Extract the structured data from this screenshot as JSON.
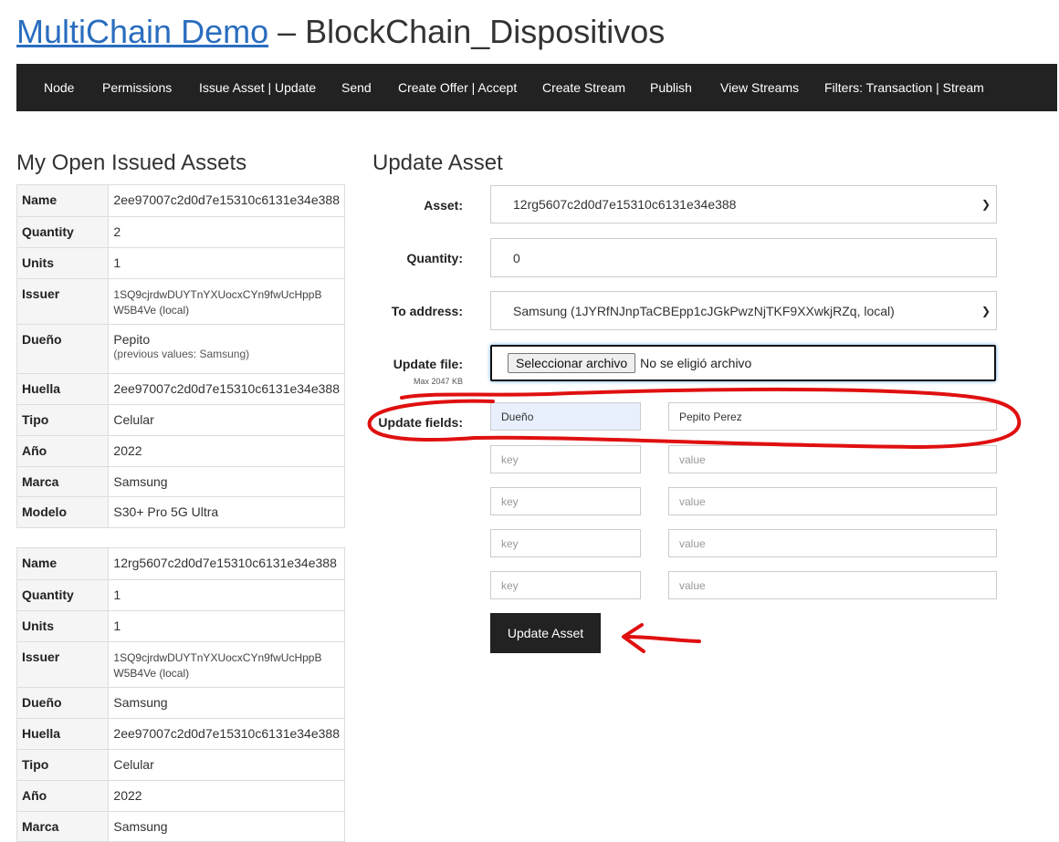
{
  "header": {
    "link_text": "MultiChain Demo",
    "rest": " – BlockChain_Dispositivos"
  },
  "nav": [
    {
      "label": "Node"
    },
    {
      "label": "Permissions"
    },
    {
      "label": "Issue Asset | Update"
    },
    {
      "label": "Send"
    },
    {
      "label": "Create Offer | Accept"
    },
    {
      "label": "Create Stream"
    },
    {
      "label": "Publish"
    },
    {
      "label": "View Streams"
    },
    {
      "label": "Filters: Transaction | Stream"
    }
  ],
  "assets_panel": {
    "title": "My Open Issued Assets",
    "assets": [
      {
        "name_label": "Name",
        "name": "2ee97007c2d0d7e15310c6131e34e388",
        "quantity_label": "Quantity",
        "quantity": "2",
        "units_label": "Units",
        "units": "1",
        "issuer_label": "Issuer",
        "issuer_line1": "1SQ9cjrdwDUYTnYXUocxCYn9fwUcHppB",
        "issuer_line2": "W5B4Ve (local)",
        "owner_label": "Dueño",
        "owner": "Pepito",
        "owner_previous": "(previous values: Samsung)",
        "huella_label": "Huella",
        "huella": "2ee97007c2d0d7e15310c6131e34e388",
        "tipo_label": "Tipo",
        "tipo": "Celular",
        "anio_label": "Año",
        "anio": "2022",
        "marca_label": "Marca",
        "marca": "Samsung",
        "modelo_label": "Modelo",
        "modelo": "S30+ Pro 5G Ultra"
      },
      {
        "name_label": "Name",
        "name": "12rg5607c2d0d7e15310c6131e34e388",
        "quantity_label": "Quantity",
        "quantity": "1",
        "units_label": "Units",
        "units": "1",
        "issuer_label": "Issuer",
        "issuer_line1": "1SQ9cjrdwDUYTnYXUocxCYn9fwUcHppB",
        "issuer_line2": "W5B4Ve (local)",
        "owner_label": "Dueño",
        "owner": "Samsung",
        "huella_label": "Huella",
        "huella": "2ee97007c2d0d7e15310c6131e34e388",
        "tipo_label": "Tipo",
        "tipo": "Celular",
        "anio_label": "Año",
        "anio": "2022",
        "marca_label": "Marca",
        "marca": "Samsung"
      }
    ]
  },
  "form": {
    "title": "Update Asset",
    "asset_label": "Asset:",
    "asset_value": "12rg5607c2d0d7e15310c6131e34e388",
    "quantity_label": "Quantity:",
    "quantity_value": "0",
    "address_label": "To address:",
    "address_value": "Samsung (1JYRfNJnpTaCBEpp1cJGkPwzNjTKF9XXwkjRZq, local)",
    "file_label": "Update file:",
    "file_sub": "Max 2047 KB",
    "file_button": "Seleccionar archivo",
    "file_status": "No se eligió archivo",
    "fields_label": "Update fields:",
    "fields": [
      {
        "key": "Dueño",
        "value": "Pepito Perez"
      },
      {
        "key": "",
        "value": ""
      },
      {
        "key": "",
        "value": ""
      },
      {
        "key": "",
        "value": ""
      },
      {
        "key": "",
        "value": ""
      }
    ],
    "key_placeholder": "key",
    "value_placeholder": "value",
    "submit_label": "Update Asset"
  },
  "colors": {
    "link": "#2a6dbf",
    "navbar": "#222222",
    "annotation": "#e01010",
    "key_highlight": "#e8f0fe"
  },
  "icons": {
    "select_arrow": "chevron-down-icon"
  }
}
